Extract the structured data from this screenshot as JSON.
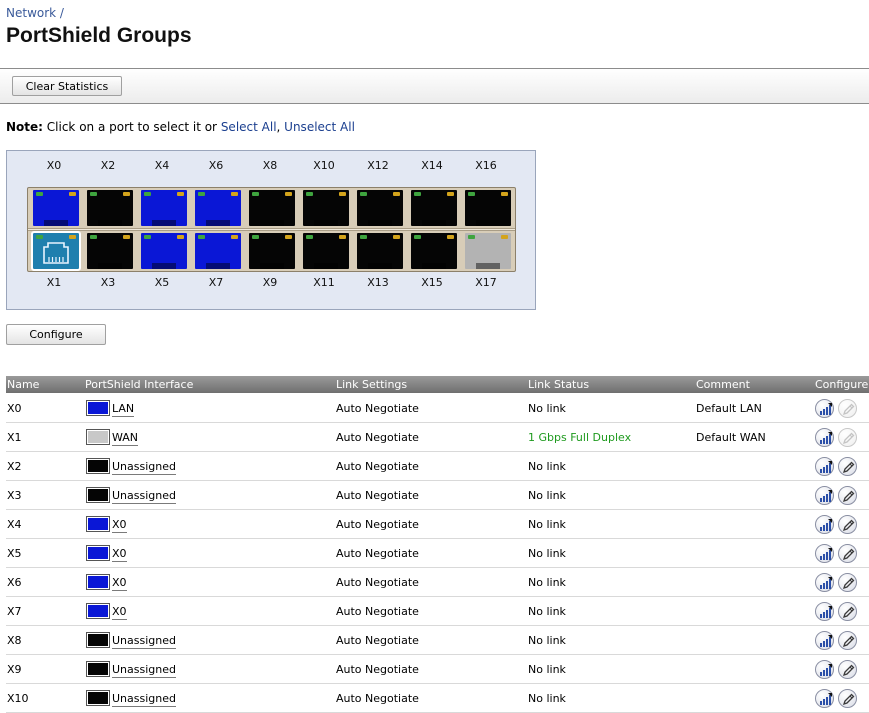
{
  "breadcrumb": {
    "parent": "Network /"
  },
  "page": {
    "title": "PortShield Groups"
  },
  "toolbar": {
    "clear_statistics": "Clear Statistics"
  },
  "note": {
    "label": "Note:",
    "text": " Click on a port to select it or ",
    "select_all": "Select All",
    "separator": ", ",
    "unselect_all": "Unselect All"
  },
  "switch": {
    "top_ports": [
      {
        "label": "X0",
        "color": "#0a17d6"
      },
      {
        "label": "X2",
        "color": "#050505"
      },
      {
        "label": "X4",
        "color": "#0a17d6"
      },
      {
        "label": "X6",
        "color": "#0a17d6"
      },
      {
        "label": "X8",
        "color": "#050505"
      },
      {
        "label": "X10",
        "color": "#050505"
      },
      {
        "label": "X12",
        "color": "#050505"
      },
      {
        "label": "X14",
        "color": "#050505"
      },
      {
        "label": "X16",
        "color": "#050505"
      }
    ],
    "bottom_ports": [
      {
        "label": "X1",
        "color": "#1f7fae",
        "selected": true
      },
      {
        "label": "X3",
        "color": "#050505"
      },
      {
        "label": "X5",
        "color": "#0a17d6"
      },
      {
        "label": "X7",
        "color": "#0a17d6"
      },
      {
        "label": "X9",
        "color": "#050505"
      },
      {
        "label": "X11",
        "color": "#050505"
      },
      {
        "label": "X13",
        "color": "#050505"
      },
      {
        "label": "X15",
        "color": "#050505"
      },
      {
        "label": "X17",
        "color": "#b3b3b3"
      }
    ]
  },
  "configure_button": "Configure",
  "table": {
    "headers": {
      "name": "Name",
      "interface": "PortShield Interface",
      "link_settings": "Link Settings",
      "link_status": "Link Status",
      "comment": "Comment",
      "configure": "Configure"
    },
    "rows": [
      {
        "name": "X0",
        "swatch": "#0a17d6",
        "interface": "LAN",
        "link_settings": "Auto Negotiate",
        "link_status": "No link",
        "status_ok": false,
        "comment": "Default LAN",
        "edit_enabled": false
      },
      {
        "name": "X1",
        "swatch": "#c8c8c8",
        "interface": "WAN",
        "link_settings": "Auto Negotiate",
        "link_status": "1 Gbps Full Duplex",
        "status_ok": true,
        "comment": "Default WAN",
        "edit_enabled": false
      },
      {
        "name": "X2",
        "swatch": "#050505",
        "interface": "Unassigned",
        "link_settings": "Auto Negotiate",
        "link_status": "No link",
        "status_ok": false,
        "comment": "",
        "edit_enabled": true
      },
      {
        "name": "X3",
        "swatch": "#050505",
        "interface": "Unassigned",
        "link_settings": "Auto Negotiate",
        "link_status": "No link",
        "status_ok": false,
        "comment": "",
        "edit_enabled": true
      },
      {
        "name": "X4",
        "swatch": "#0a17d6",
        "interface": "X0",
        "link_settings": "Auto Negotiate",
        "link_status": "No link",
        "status_ok": false,
        "comment": "",
        "edit_enabled": true
      },
      {
        "name": "X5",
        "swatch": "#0a17d6",
        "interface": "X0",
        "link_settings": "Auto Negotiate",
        "link_status": "No link",
        "status_ok": false,
        "comment": "",
        "edit_enabled": true
      },
      {
        "name": "X6",
        "swatch": "#0a17d6",
        "interface": "X0",
        "link_settings": "Auto Negotiate",
        "link_status": "No link",
        "status_ok": false,
        "comment": "",
        "edit_enabled": true
      },
      {
        "name": "X7",
        "swatch": "#0a17d6",
        "interface": "X0",
        "link_settings": "Auto Negotiate",
        "link_status": "No link",
        "status_ok": false,
        "comment": "",
        "edit_enabled": true
      },
      {
        "name": "X8",
        "swatch": "#050505",
        "interface": "Unassigned",
        "link_settings": "Auto Negotiate",
        "link_status": "No link",
        "status_ok": false,
        "comment": "",
        "edit_enabled": true
      },
      {
        "name": "X9",
        "swatch": "#050505",
        "interface": "Unassigned",
        "link_settings": "Auto Negotiate",
        "link_status": "No link",
        "status_ok": false,
        "comment": "",
        "edit_enabled": true
      },
      {
        "name": "X10",
        "swatch": "#050505",
        "interface": "Unassigned",
        "link_settings": "Auto Negotiate",
        "link_status": "No link",
        "status_ok": false,
        "comment": "",
        "edit_enabled": true
      }
    ]
  },
  "icons": {
    "statistics": "statistics-icon",
    "edit": "edit-pencil-icon"
  }
}
